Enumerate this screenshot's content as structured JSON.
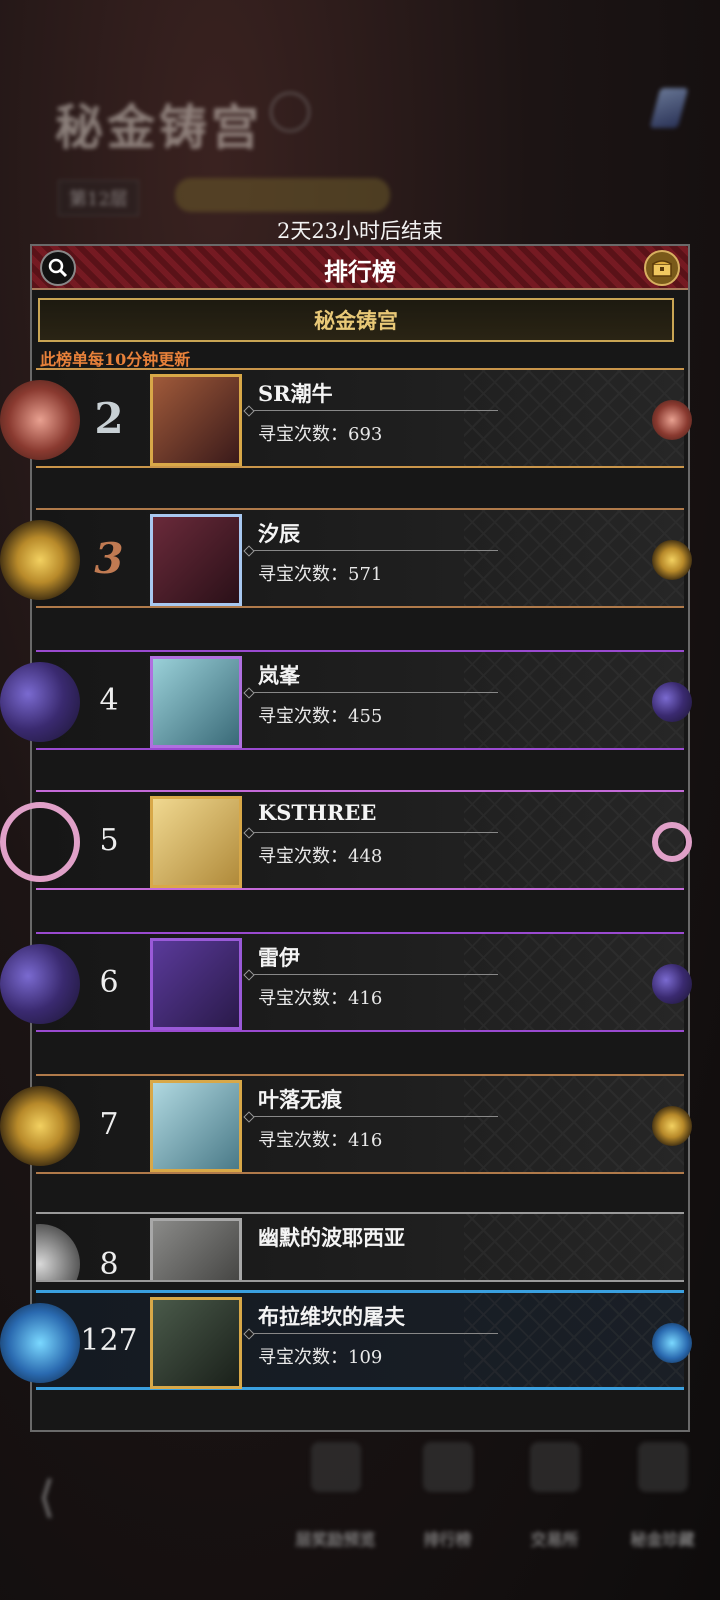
{
  "background": {
    "title": "秘金铸宫",
    "floor": "第12层"
  },
  "timer_text": "2天23小时后结束",
  "panel": {
    "title": "排行榜",
    "tab": "秘金铸宫",
    "update_note": "此榜单每10分钟更新",
    "count_label": "寻宝次数："
  },
  "rows": [
    {
      "rank": "2",
      "name": "SR潮牛",
      "count": "寻宝次数：693"
    },
    {
      "rank": "3",
      "name": "汐辰",
      "count": "寻宝次数：571"
    },
    {
      "rank": "4",
      "name": "岚峯",
      "count": "寻宝次数：455"
    },
    {
      "rank": "5",
      "name": "KSTHREE",
      "count": "寻宝次数：448"
    },
    {
      "rank": "6",
      "name": "雷伊",
      "count": "寻宝次数：416"
    },
    {
      "rank": "7",
      "name": "叶落无痕",
      "count": "寻宝次数：416"
    },
    {
      "rank": "8",
      "name": "幽默的波耶西亚",
      "count": ""
    }
  ],
  "my_row": {
    "rank": "127",
    "name": "布拉维坎的屠夫",
    "count": "寻宝次数：109"
  },
  "bottom_nav": {
    "items": [
      "层奖励预览",
      "排行榜",
      "交易所",
      "秘金珍藏"
    ]
  },
  "colors": {
    "accent_gold": "#e8c877",
    "note_orange": "#e8813a",
    "panel_red": "#751a22",
    "my_row_blue": "#3aa0e0"
  }
}
